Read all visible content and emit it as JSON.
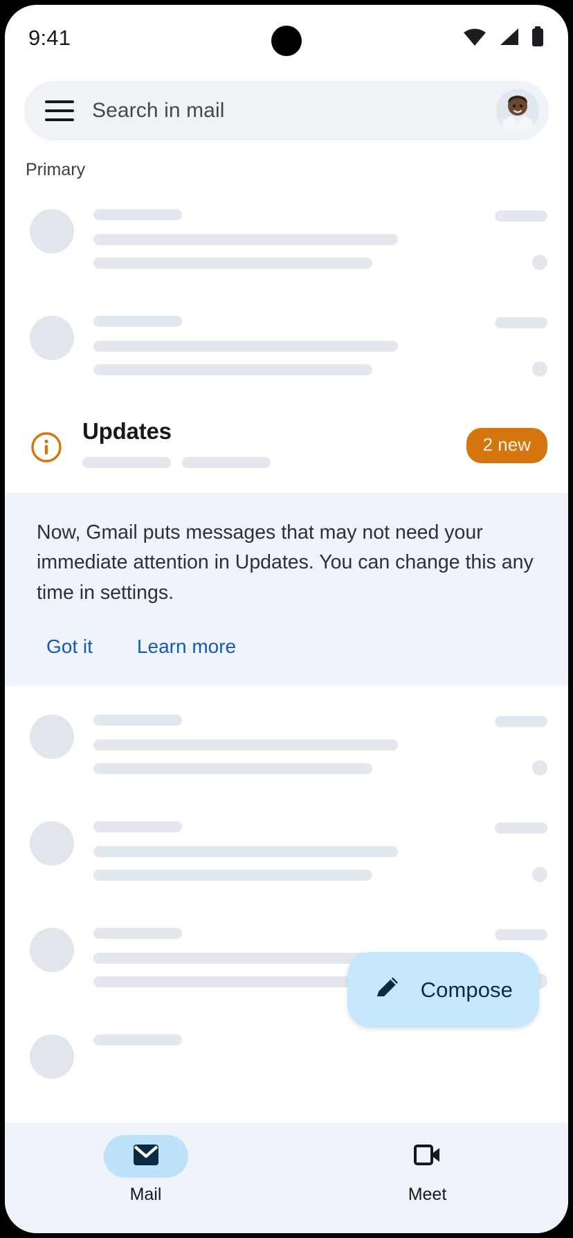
{
  "status_bar": {
    "time": "9:41",
    "icons": [
      "wifi-icon",
      "cellular-signal-icon",
      "battery-icon"
    ]
  },
  "search": {
    "menu_icon": "hamburger-menu-icon",
    "placeholder": "Search in mail",
    "value": "",
    "avatar": "user-avatar"
  },
  "category": {
    "label": "Primary"
  },
  "updates_section": {
    "icon": "info-icon",
    "title": "Updates",
    "badge": "2 new",
    "badge_color": "#d4760d",
    "icon_color": "#d4760d"
  },
  "banner": {
    "text": "Now, Gmail puts messages that may not need your immediate attention in Updates. You can change this any time in settings.",
    "actions": [
      {
        "label": "Got it",
        "name": "got-it-button"
      },
      {
        "label": "Learn more",
        "name": "learn-more-button"
      }
    ],
    "background": "#eff3fa",
    "link_color": "#1659ae"
  },
  "compose": {
    "label": "Compose",
    "icon": "pencil-icon",
    "background": "#c5e7fc"
  },
  "bottom_nav": {
    "items": [
      {
        "label": "Mail",
        "icon": "envelope-icon",
        "active": true
      },
      {
        "label": "Meet",
        "icon": "video-camera-icon",
        "active": false
      }
    ],
    "background": "#eff3fa",
    "active_pill_color": "#bfe2fb"
  },
  "skeleton": {
    "placeholder_color": "#e3e8ee",
    "rows_above_updates": 2,
    "rows_below_banner": 3
  }
}
